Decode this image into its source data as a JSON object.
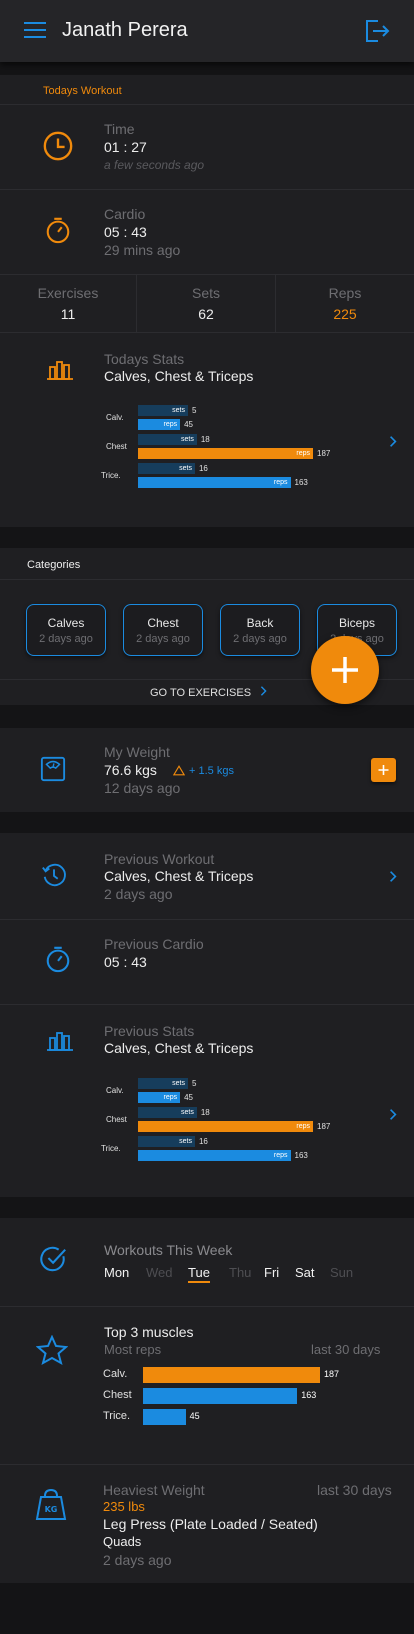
{
  "header": {
    "title": "Janath Perera",
    "menu_icon": "hamburger-icon",
    "logout_icon": "logout-icon"
  },
  "today": {
    "section_label": "Todays Workout",
    "time": {
      "label": "Time",
      "value": "01 : 27",
      "ago": "a few seconds ago"
    },
    "cardio": {
      "label": "Cardio",
      "value": "05 : 43",
      "ago": "29 mins ago"
    },
    "summary": [
      {
        "label": "Exercises",
        "value": "11"
      },
      {
        "label": "Sets",
        "value": "62"
      },
      {
        "label": "Reps",
        "value": "225"
      }
    ],
    "stats": {
      "label": "Todays Stats",
      "title": "Calves, Chest & Triceps"
    }
  },
  "chart_data": [
    {
      "type": "bar",
      "categories": [
        "Calv.",
        "Chest",
        "Trice."
      ],
      "series": [
        {
          "name": "sets",
          "values": [
            5,
            18,
            16
          ]
        },
        {
          "name": "reps",
          "values": [
            45,
            187,
            163
          ]
        }
      ],
      "colors": {
        "sets": "#163d5c",
        "reps": "#1b8be0",
        "highlight": "#f08a0c"
      }
    },
    {
      "type": "bar",
      "categories": [
        "Calv.",
        "Chest",
        "Trice."
      ],
      "series": [
        {
          "name": "sets",
          "values": [
            5,
            18,
            16
          ]
        },
        {
          "name": "reps",
          "values": [
            45,
            187,
            163
          ]
        }
      ]
    },
    {
      "type": "bar",
      "categories": [
        "Calv.",
        "Chest",
        "Trice."
      ],
      "values": [
        187,
        163,
        45
      ]
    }
  ],
  "categories": {
    "label": "Categories",
    "items": [
      {
        "name": "Calves",
        "ago": "2 days ago"
      },
      {
        "name": "Chest",
        "ago": "2 days ago"
      },
      {
        "name": "Back",
        "ago": "2 days ago"
      },
      {
        "name": "Biceps",
        "ago": "2 days ago"
      }
    ],
    "goto": "GO TO EXERCISES"
  },
  "weight": {
    "label": "My  Weight",
    "value": "76.6 kgs",
    "change": "+ 1.5 kgs",
    "ago": "12 days ago"
  },
  "previous": {
    "workout": {
      "label": "Previous Workout",
      "title": "Calves, Chest & Triceps",
      "ago": "2 days ago"
    },
    "cardio": {
      "label": "Previous Cardio",
      "value": "05 : 43"
    },
    "stats": {
      "label": "Previous Stats",
      "title": "Calves, Chest & Triceps"
    }
  },
  "week": {
    "label": "Workouts This Week",
    "days": [
      {
        "name": "Mon",
        "done": true
      },
      {
        "name": "Wed",
        "done": false
      },
      {
        "name": "Tue",
        "done": true,
        "today": true
      },
      {
        "name": "Thu",
        "done": false
      },
      {
        "name": "Fri",
        "done": true
      },
      {
        "name": "Sat",
        "done": true
      },
      {
        "name": "Sun",
        "done": false
      }
    ]
  },
  "top_muscles": {
    "title": "Top 3 muscles",
    "sub": "Most reps",
    "range": "last 30 days"
  },
  "heaviest": {
    "label": "Heaviest Weight",
    "range": "last 30 days",
    "value": "235 lbs",
    "exercise": "Leg Press (Plate Loaded / Seated)",
    "muscle": "Quads",
    "ago": "2 days ago"
  }
}
